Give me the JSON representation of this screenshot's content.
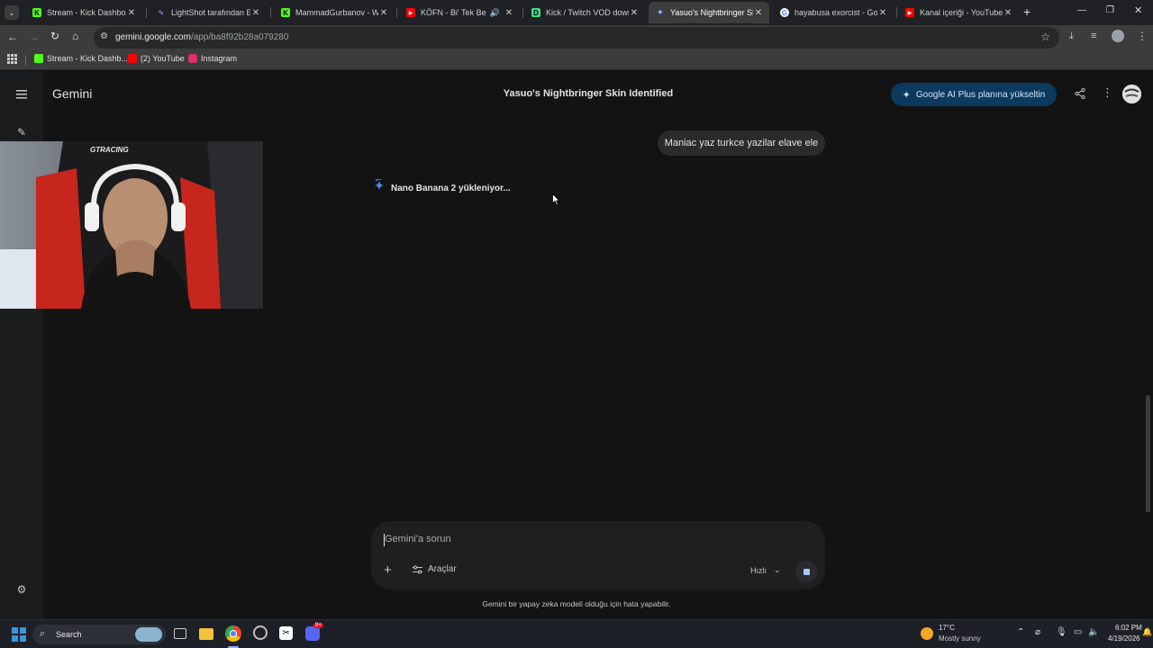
{
  "browser": {
    "tabs": [
      {
        "title": "Stream - Kick Dashboard",
        "favicon": "kick-logo-icon",
        "color": "#53fc18"
      },
      {
        "title": "LightShot tarafından Ekra",
        "favicon": "feather-pen-icon",
        "color": "#b48cff"
      },
      {
        "title": "MammadGurbanov - Wat",
        "favicon": "kick-logo-icon",
        "color": "#53fc18"
      },
      {
        "title": "KÖFN - Bi' Tek Ben An",
        "favicon": "youtube-icon",
        "color": "#ff0000"
      },
      {
        "title": "Kick / Twitch VOD downlo",
        "favicon": "d-logo-icon",
        "color": "#3ddc84"
      },
      {
        "title": "Yasuo's Nightbringer Skin",
        "favicon": "gemini-spark-icon",
        "color": "#8ab4f8"
      },
      {
        "title": "hayabusa exorcist - Goog",
        "favicon": "google-icon",
        "color": "#ffffff"
      },
      {
        "title": "Kanal içeriği - YouTube St",
        "favicon": "youtube-studio-icon",
        "color": "#ff0000"
      }
    ],
    "active_tab_index": 5,
    "url_host": "gemini.google.com",
    "url_path": "/app/ba8f92b28a079280",
    "bookmarks": [
      {
        "label": "Stream - Kick Dashb...",
        "icon": "kick-logo-icon",
        "color": "#53fc18"
      },
      {
        "label": "(2) YouTube",
        "icon": "youtube-icon",
        "color": "#ff0000"
      },
      {
        "label": "Instagram",
        "icon": "instagram-icon",
        "color": "#e1306c"
      }
    ]
  },
  "gemini": {
    "brand": "Gemini",
    "conversation_title": "Yasuo's Nightbringer Skin Identified",
    "upgrade_label": "Google AI Plus planına yükseltin",
    "user_message": "Maniac yaz turkce yazilar elave ele",
    "loading_text": "Nano Banana 2 yükleniyor...",
    "input_placeholder": "Gemini'a sorun",
    "tools_label": "Araçlar",
    "mode_label": "Hızlı",
    "disclaimer": "Gemini bir yapay zeka modeli olduğu için hata yapabilir.",
    "accent": "#4a8df8"
  },
  "taskbar": {
    "search_label": "Search",
    "weather_temp": "17°C",
    "weather_desc": "Mostly sunny",
    "time": "6:02 PM",
    "date": "4/19/2026",
    "discord_badge": "9+"
  }
}
